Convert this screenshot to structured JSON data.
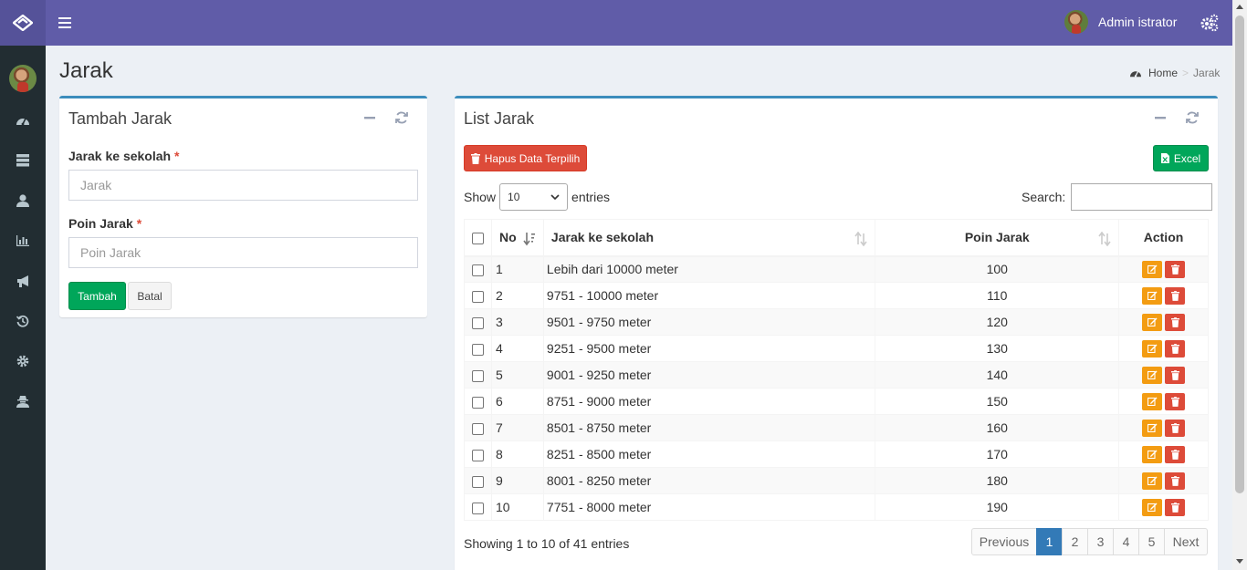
{
  "app": {
    "user_name": "Admin istrator"
  },
  "header": {
    "title": "Jarak",
    "breadcrumb": {
      "home": "Home",
      "current": "Jarak"
    }
  },
  "sidebar": {
    "icons": [
      "dashboard-icon",
      "database-icon",
      "user-icon",
      "bar-chart-icon",
      "bullhorn-icon",
      "history-icon",
      "gear-icon",
      "user-secret-icon"
    ]
  },
  "form_box": {
    "title": "Tambah Jarak",
    "field1": {
      "label": "Jarak ke sekolah",
      "placeholder": "Jarak",
      "value": ""
    },
    "field2": {
      "label": "Poin Jarak",
      "placeholder": "Poin Jarak",
      "value": ""
    },
    "required_mark": "*",
    "add_label": "Tambah",
    "cancel_label": "Batal"
  },
  "list_box": {
    "title": "List Jarak",
    "delete_selected_label": "Hapus Data Terpilih",
    "excel_label": "Excel",
    "show_label": "Show",
    "entries_label": "entries",
    "page_length": "10",
    "search_label": "Search:",
    "search_value": "",
    "columns": [
      "No",
      "Jarak ke sekolah",
      "Poin Jarak",
      "Action"
    ],
    "rows": [
      {
        "no": "1",
        "jarak": "Lebih dari 10000 meter",
        "poin": "100"
      },
      {
        "no": "2",
        "jarak": "9751 - 10000 meter",
        "poin": "110"
      },
      {
        "no": "3",
        "jarak": "9501 - 9750 meter",
        "poin": "120"
      },
      {
        "no": "4",
        "jarak": "9251 - 9500 meter",
        "poin": "130"
      },
      {
        "no": "5",
        "jarak": "9001 - 9250 meter",
        "poin": "140"
      },
      {
        "no": "6",
        "jarak": "8751 - 9000 meter",
        "poin": "150"
      },
      {
        "no": "7",
        "jarak": "8501 - 8750 meter",
        "poin": "160"
      },
      {
        "no": "8",
        "jarak": "8251 - 8500 meter",
        "poin": "170"
      },
      {
        "no": "9",
        "jarak": "8001 - 8250 meter",
        "poin": "180"
      },
      {
        "no": "10",
        "jarak": "7751 - 8000 meter",
        "poin": "190"
      }
    ],
    "info": "Showing 1 to 10 of 41 entries",
    "pagination": {
      "previous": "Previous",
      "pages": [
        "1",
        "2",
        "3",
        "4",
        "5"
      ],
      "active_page": "1",
      "next": "Next"
    }
  },
  "colors": {
    "topbar": "#605ca8",
    "sidebar": "#222d32",
    "box_border": "#3c8dbc",
    "success": "#00a65a",
    "danger": "#dd4b39",
    "warning": "#f39c12",
    "page_active": "#337ab7"
  }
}
